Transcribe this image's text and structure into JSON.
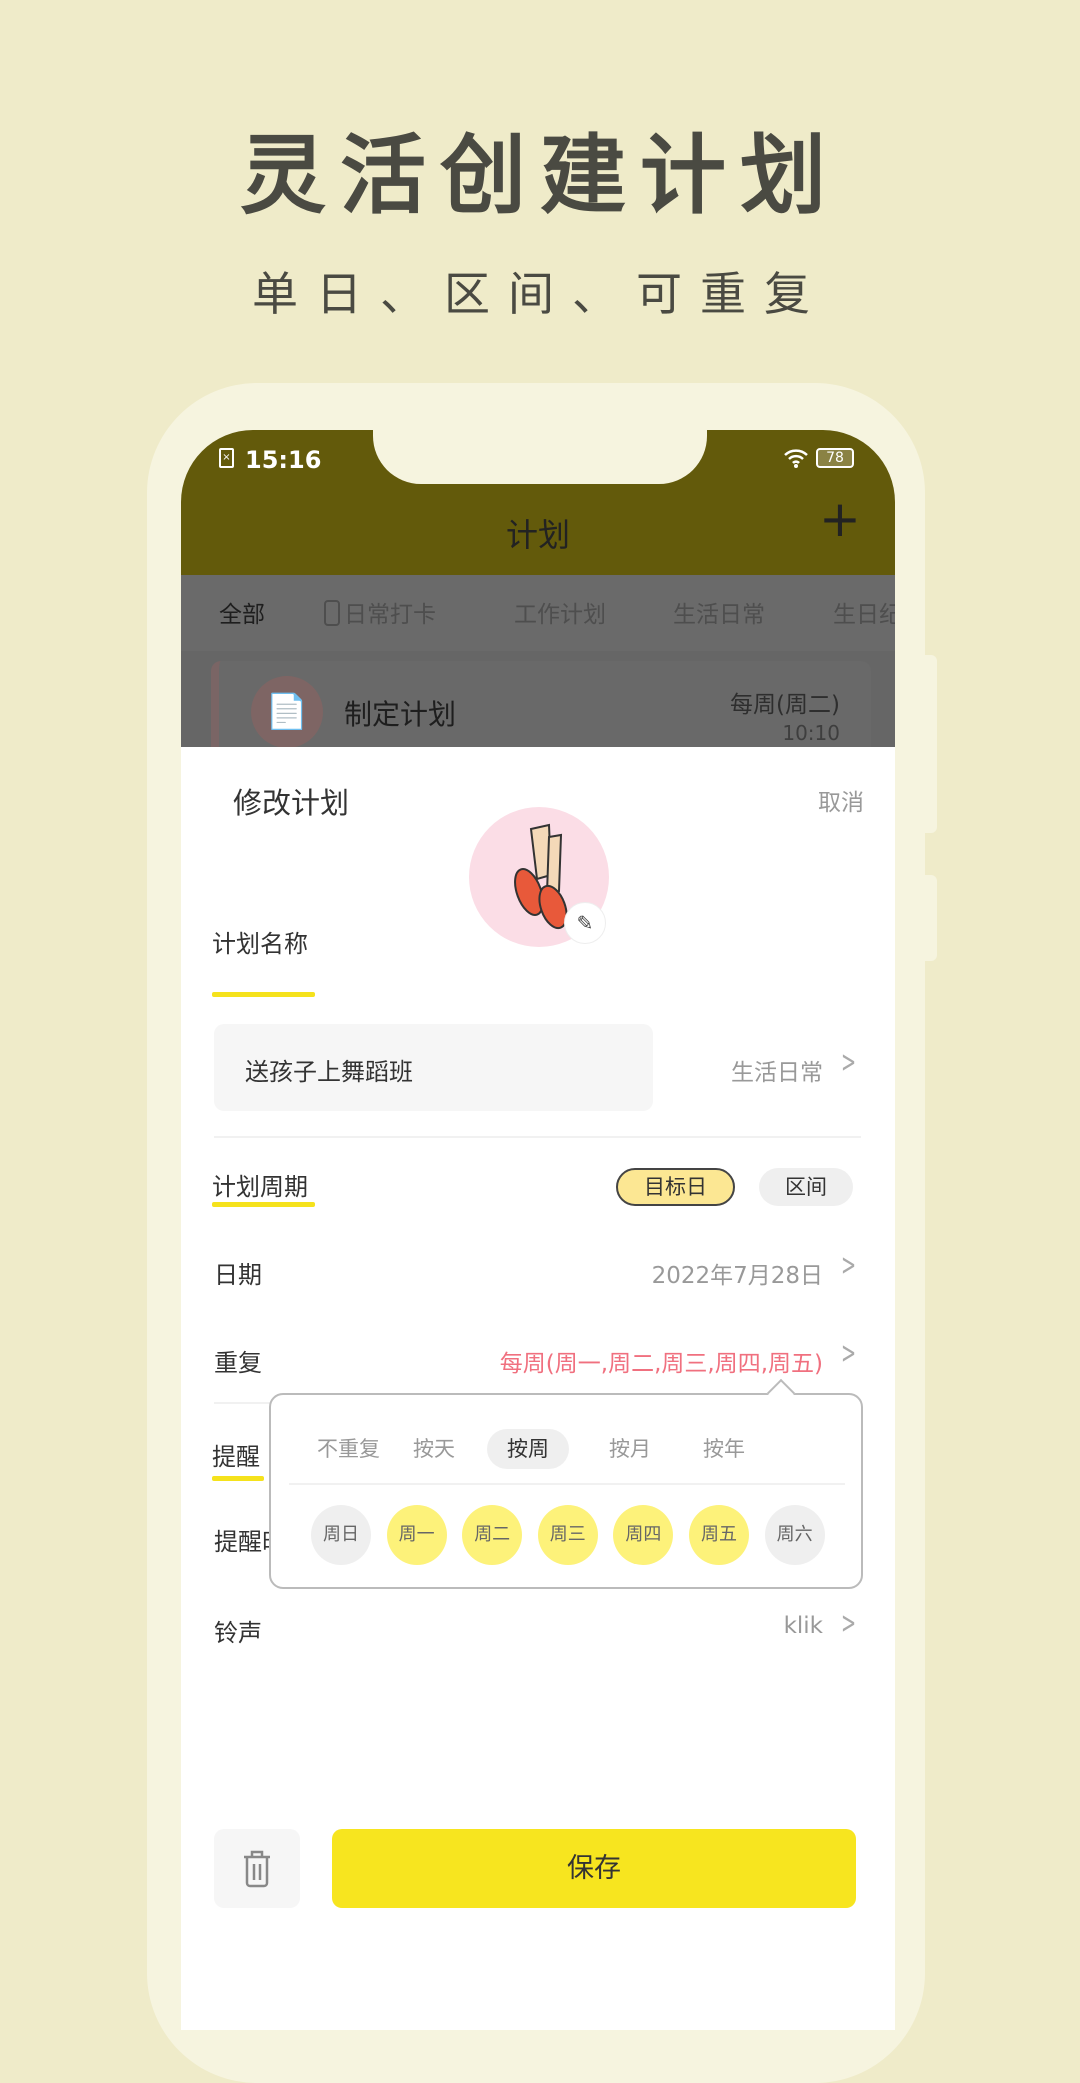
{
  "hero": {
    "title": "灵活创建计划",
    "subtitle": "单日、区间、可重复"
  },
  "status": {
    "time": "15:16",
    "battery": "78"
  },
  "nav": {
    "title": "计划",
    "add_icon": "+"
  },
  "tabs": [
    "全部",
    "日常打卡",
    "工作计划",
    "生活日常",
    "生日纪"
  ],
  "card": {
    "title": "制定计划",
    "repeat": "每周(周二)",
    "time": "10:10"
  },
  "sheet": {
    "title": "修改计划",
    "cancel": "取消",
    "name_label": "计划名称",
    "name_value": "送孩子上舞蹈班",
    "category": "生活日常",
    "cycle_label": "计划周期",
    "cycle_options": [
      "目标日",
      "区间"
    ],
    "date_label": "日期",
    "date_value": "2022年7月28日",
    "repeat_label": "重复",
    "repeat_value": "每周(周一,周二,周三,周四,周五)",
    "remind_label": "提醒",
    "remind_time_label": "提醒时",
    "ring_label": "铃声",
    "ring_value": "klik",
    "save": "保存"
  },
  "popup": {
    "modes": [
      "不重复",
      "按天",
      "按周",
      "按月",
      "按年"
    ],
    "selected_mode": "按周",
    "days": [
      {
        "label": "周日",
        "on": false
      },
      {
        "label": "周一",
        "on": true
      },
      {
        "label": "周二",
        "on": true
      },
      {
        "label": "周三",
        "on": true
      },
      {
        "label": "周四",
        "on": true
      },
      {
        "label": "周五",
        "on": true
      },
      {
        "label": "周六",
        "on": false
      }
    ]
  },
  "colors": {
    "accent": "#f7e51f",
    "header": "#635a0b",
    "repeat": "#f0707f"
  }
}
